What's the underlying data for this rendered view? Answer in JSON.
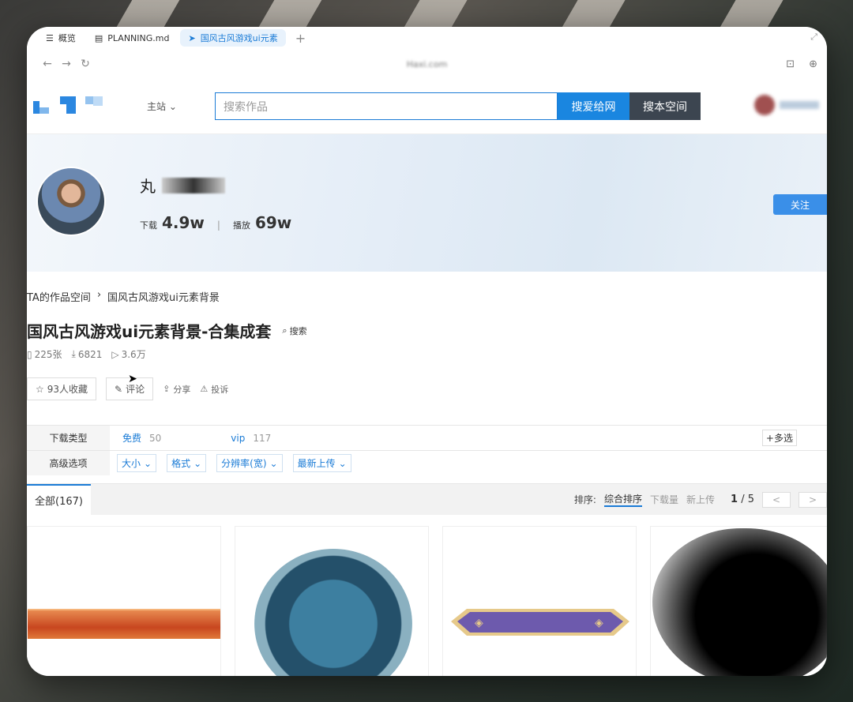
{
  "browser": {
    "tabs": [
      {
        "label": "概览",
        "icon": "list-icon"
      },
      {
        "label": "PLANNING.md",
        "icon": "file-icon"
      },
      {
        "label": "国风古风游戏ui元素",
        "icon": "cursor-tab-icon"
      }
    ],
    "url": "Haxi.com"
  },
  "header": {
    "main_site": "主站",
    "search_placeholder": "搜索作品",
    "search_button": "搜爱给网",
    "search_space_button": "搜本空间"
  },
  "profile": {
    "name_prefix": "丸",
    "download_label": "下载",
    "download_value": "4.9w",
    "play_label": "播放",
    "play_value": "69w",
    "follow_button": "关注"
  },
  "breadcrumb": {
    "parent": "TA的作品空间",
    "current": "国风古风游戏ui元素背景"
  },
  "collection": {
    "title": "国风古风游戏ui元素背景-合集成套",
    "search_link": "搜索",
    "file_count": "225张",
    "downloads": "6821",
    "views": "3.6万"
  },
  "actions": {
    "favorite": "93人收藏",
    "comment": "评论",
    "share": "分享",
    "report": "投诉"
  },
  "filters": {
    "download_type_label": "下载类型",
    "free_label": "免费",
    "free_count": "50",
    "vip_label": "vip",
    "vip_count": "117",
    "multi_select": "多选",
    "advanced_label": "高级选项",
    "dropdowns": [
      "大小",
      "格式",
      "分辨率(宽)",
      "最新上传"
    ]
  },
  "sortbar": {
    "all_tab": "全部(167)",
    "sort_label": "排序:",
    "options": [
      "综合排序",
      "下载量",
      "新上传"
    ],
    "page_current": "1",
    "page_sep": "/",
    "page_total": "5",
    "prev": "<",
    "next": ">"
  }
}
